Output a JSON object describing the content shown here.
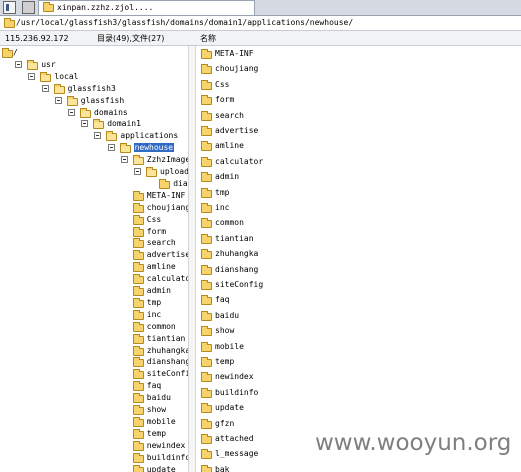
{
  "tab": {
    "title": "xinpan.zzhz.zjol...."
  },
  "path": {
    "current": "/usr/local/glassfish3/glassfish/domains/domain1/applications/newhouse/"
  },
  "header": {
    "ip": "115.236.92.172",
    "count": "目录(49),文件(27)",
    "column_name": "名称"
  },
  "tree": [
    {
      "label": "/",
      "depth": 0,
      "expander": false,
      "icon": "drive-icon"
    },
    {
      "label": "usr",
      "depth": 1,
      "expander": true
    },
    {
      "label": "local",
      "depth": 2,
      "expander": true
    },
    {
      "label": "glassfish3",
      "depth": 3,
      "expander": true
    },
    {
      "label": "glassfish",
      "depth": 4,
      "expander": true
    },
    {
      "label": "domains",
      "depth": 5,
      "expander": true
    },
    {
      "label": "domain1",
      "depth": 6,
      "expander": true
    },
    {
      "label": "applications",
      "depth": 7,
      "expander": true
    },
    {
      "label": "newhouse",
      "depth": 8,
      "expander": true,
      "selected": true
    },
    {
      "label": "ZzhzImages",
      "depth": 9,
      "expander": true
    },
    {
      "label": "upload",
      "depth": 10,
      "expander": true
    },
    {
      "label": "dianshang",
      "depth": 11,
      "expander": false
    },
    {
      "label": "META-INF",
      "depth": 9,
      "expander": false
    },
    {
      "label": "choujiang",
      "depth": 9,
      "expander": false
    },
    {
      "label": "Css",
      "depth": 9,
      "expander": false
    },
    {
      "label": "form",
      "depth": 9,
      "expander": false
    },
    {
      "label": "search",
      "depth": 9,
      "expander": false
    },
    {
      "label": "advertise",
      "depth": 9,
      "expander": false
    },
    {
      "label": "amline",
      "depth": 9,
      "expander": false
    },
    {
      "label": "calculator",
      "depth": 9,
      "expander": false
    },
    {
      "label": "admin",
      "depth": 9,
      "expander": false
    },
    {
      "label": "tmp",
      "depth": 9,
      "expander": false
    },
    {
      "label": "inc",
      "depth": 9,
      "expander": false
    },
    {
      "label": "common",
      "depth": 9,
      "expander": false
    },
    {
      "label": "tiantian",
      "depth": 9,
      "expander": false
    },
    {
      "label": "zhuhangka",
      "depth": 9,
      "expander": false
    },
    {
      "label": "dianshang",
      "depth": 9,
      "expander": false
    },
    {
      "label": "siteConfig",
      "depth": 9,
      "expander": false
    },
    {
      "label": "faq",
      "depth": 9,
      "expander": false
    },
    {
      "label": "baidu",
      "depth": 9,
      "expander": false
    },
    {
      "label": "show",
      "depth": 9,
      "expander": false
    },
    {
      "label": "mobile",
      "depth": 9,
      "expander": false
    },
    {
      "label": "temp",
      "depth": 9,
      "expander": false
    },
    {
      "label": "newindex",
      "depth": 9,
      "expander": false
    },
    {
      "label": "buildinfo",
      "depth": 9,
      "expander": false
    },
    {
      "label": "update",
      "depth": 9,
      "expander": false
    }
  ],
  "list": [
    "META-INF",
    "choujiang",
    "Css",
    "form",
    "search",
    "advertise",
    "amline",
    "calculator",
    "admin",
    "tmp",
    "inc",
    "common",
    "tiantian",
    "zhuhangka",
    "dianshang",
    "siteConfig",
    "faq",
    "baidu",
    "show",
    "mobile",
    "temp",
    "newindex",
    "buildinfo",
    "update",
    "gfzn",
    "attached",
    "l_message",
    "bak"
  ],
  "watermark": "www.wooyun.org"
}
